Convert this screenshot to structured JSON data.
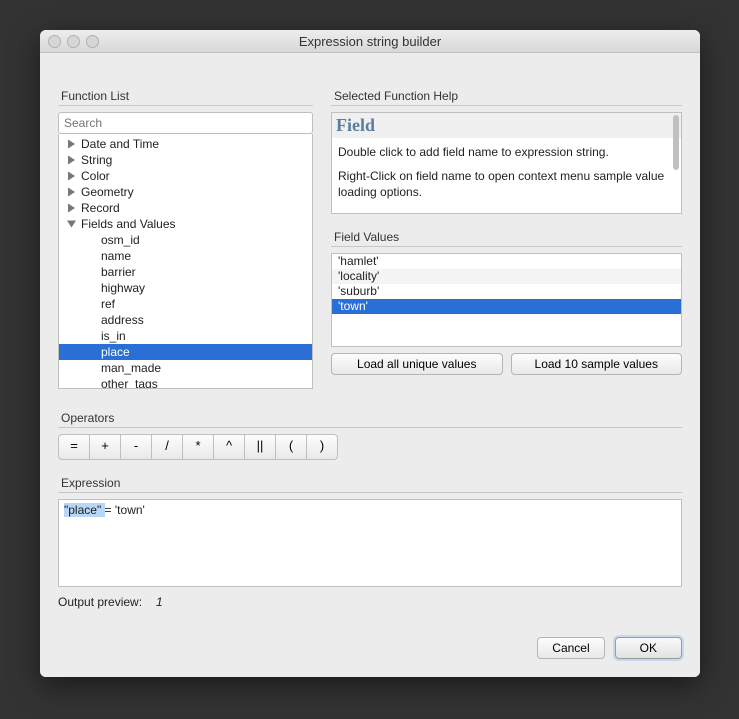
{
  "window": {
    "title": "Expression string builder"
  },
  "function_list": {
    "label": "Function List",
    "search_placeholder": "Search",
    "items": [
      {
        "label": "Date and Time",
        "expanded": false,
        "depth": 0
      },
      {
        "label": "String",
        "expanded": false,
        "depth": 0
      },
      {
        "label": "Color",
        "expanded": false,
        "depth": 0
      },
      {
        "label": "Geometry",
        "expanded": false,
        "depth": 0
      },
      {
        "label": "Record",
        "expanded": false,
        "depth": 0
      },
      {
        "label": "Fields and Values",
        "expanded": true,
        "depth": 0
      },
      {
        "label": "osm_id",
        "depth": 1
      },
      {
        "label": "name",
        "depth": 1
      },
      {
        "label": "barrier",
        "depth": 1
      },
      {
        "label": "highway",
        "depth": 1
      },
      {
        "label": "ref",
        "depth": 1
      },
      {
        "label": "address",
        "depth": 1
      },
      {
        "label": "is_in",
        "depth": 1
      },
      {
        "label": "place",
        "depth": 1,
        "selected": true
      },
      {
        "label": "man_made",
        "depth": 1
      },
      {
        "label": "other_tags",
        "depth": 1
      }
    ]
  },
  "help": {
    "label": "Selected Function Help",
    "title": "Field",
    "line1": "Double click to add field name to expression string.",
    "line2": "Right-Click on field name to open context menu sample value loading options."
  },
  "field_values": {
    "label": "Field Values",
    "items": [
      {
        "label": "'hamlet'"
      },
      {
        "label": "'locality'"
      },
      {
        "label": "'suburb'"
      },
      {
        "label": "'town'",
        "selected": true
      }
    ],
    "load_all": "Load all unique values",
    "load_10": "Load 10 sample values"
  },
  "operators": {
    "label": "Operators",
    "ops": [
      "=",
      "+",
      "-",
      "/",
      "*",
      "^",
      "||",
      "(",
      ")"
    ]
  },
  "expression": {
    "label": "Expression",
    "highlighted": "\"place\" ",
    "rest": " =  'town'"
  },
  "output": {
    "label": "Output preview:",
    "value": "1"
  },
  "footer": {
    "cancel": "Cancel",
    "ok": "OK"
  }
}
